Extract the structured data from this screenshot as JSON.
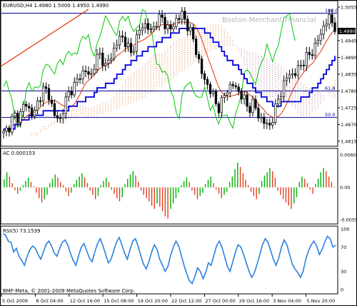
{
  "chart_data": [
    {
      "type": "candlestick",
      "title": "EURUSD,H4 1.4980 1.5000 1.4950 1.4990",
      "watermark": "Boston Merchant Financial",
      "ylim": [
        1.4615,
        1.5055
      ],
      "y_ticks": [
        "1.5055",
        "1.4945",
        "1.4890",
        "1.4835",
        "1.4780",
        "1.4725",
        "1.4670",
        "1.4615"
      ],
      "current_price": "1.4990",
      "fibonacci_levels": [
        {
          "label": "100.0",
          "value": 1.5035
        },
        {
          "label": "61.8",
          "value": 1.478
        },
        {
          "label": "50.0",
          "value": 1.4693
        }
      ],
      "ohlc_close_path": [
        1.464,
        1.466,
        1.47,
        1.469,
        1.474,
        1.472,
        1.47,
        1.476,
        1.479,
        1.476,
        1.47,
        1.468,
        1.474,
        1.478,
        1.48,
        1.483,
        1.485,
        1.482,
        1.488,
        1.49,
        1.486,
        1.489,
        1.493,
        1.496,
        1.494,
        1.49,
        1.495,
        1.499,
        1.5,
        1.497,
        1.501,
        1.502,
        1.499,
        1.498,
        1.502,
        1.503,
        1.5,
        1.496,
        1.49,
        1.483,
        1.48,
        1.477,
        1.472,
        1.475,
        1.479,
        1.48,
        1.478,
        1.476,
        1.472,
        1.474,
        1.47,
        1.468,
        1.466,
        1.47,
        1.476,
        1.48,
        1.484,
        1.483,
        1.486,
        1.488,
        1.49,
        1.492,
        1.496,
        1.5,
        1.502,
        1.499
      ],
      "colors": {
        "bull": "#00c800",
        "bear": "#000000",
        "kijun": "#0000e0",
        "tenkan": "#e03000",
        "chikou": "#00c800",
        "channel": "#e03000",
        "cloud_a": "#e8a070",
        "cloud_b": "#c890b0",
        "fib": "#0000a0"
      }
    },
    {
      "type": "bar",
      "title": "AC 0.000153",
      "y_ticks": [
        "0.006046",
        "0.00",
        "-0.00599"
      ],
      "ylim": [
        -0.006,
        0.006046
      ],
      "values": [
        0.0015,
        0.0028,
        0.002,
        0.0008,
        -0.0005,
        -0.0012,
        -0.0006,
        0.0004,
        0.0012,
        0.0018,
        0.001,
        0.0002,
        -0.001,
        -0.002,
        -0.0028,
        -0.0022,
        -0.0014,
        0.0008,
        0.0016,
        0.0024,
        0.0018,
        0.001,
        0.0004,
        -0.0008,
        -0.0016,
        -0.001,
        0.0006,
        0.0014,
        0.002,
        0.0026,
        0.0018,
        0.0008,
        -0.0006,
        -0.0014,
        -0.0022,
        -0.0016,
        0.0004,
        0.0012,
        0.0018,
        0.001,
        -0.0004,
        -0.0012,
        -0.002,
        -0.0026,
        -0.0018,
        0.0006,
        0.0016,
        0.0024,
        0.003,
        0.0022,
        0.001,
        -0.0006,
        -0.0014,
        -0.002,
        -0.0026,
        -0.0034,
        -0.004,
        -0.003,
        -0.0036,
        -0.0044,
        -0.0054,
        -0.0058,
        -0.004,
        -0.003,
        -0.002,
        -0.001,
        0.0004,
        0.0012,
        0.0018,
        0.001,
        -0.0006,
        -0.0014,
        -0.0022,
        -0.0016,
        -0.001,
        0.0006,
        0.0014,
        0.002,
        0.0008,
        -0.0004,
        -0.0012,
        -0.002,
        -0.0014,
        -0.0008,
        0.001,
        0.002,
        0.0034,
        0.0046,
        0.0038,
        0.0026,
        0.0014,
        0.0004,
        -0.0008,
        -0.0016,
        -0.0022,
        -0.0012,
        0.0012,
        0.0022,
        0.0028,
        0.0036,
        0.003,
        0.0018,
        -0.0006,
        -0.0014,
        -0.0022,
        -0.0028,
        -0.0034,
        -0.004,
        -0.003,
        -0.0018,
        0.001,
        0.002,
        0.0016,
        0.0008,
        -0.0004,
        -0.0012,
        0.0006,
        0.0016,
        0.0028,
        0.0036,
        0.003,
        0.002,
        0.001,
        0.00015
      ],
      "colors": {
        "up": "#00b000",
        "down": "#e04020"
      }
    },
    {
      "type": "line",
      "title": "RSI(5) 73.1539",
      "y_ticks": [
        "100",
        "70",
        "30",
        "0"
      ],
      "ylim": [
        0,
        100
      ],
      "values": [
        92,
        90,
        80,
        78,
        62,
        68,
        55,
        48,
        40,
        55,
        66,
        72,
        68,
        58,
        50,
        62,
        75,
        80,
        72,
        60,
        55,
        68,
        78,
        82,
        74,
        60,
        48,
        40,
        56,
        70,
        76,
        64,
        52,
        46,
        62,
        76,
        84,
        72,
        58,
        44,
        50,
        64,
        78,
        86,
        74,
        60,
        50,
        66,
        80,
        84,
        72,
        56,
        42,
        34,
        46,
        62,
        74,
        66,
        50,
        40,
        30,
        38,
        56,
        70,
        80,
        72,
        56,
        40,
        26,
        14,
        10,
        22,
        36,
        30,
        18,
        28,
        44,
        40,
        56,
        72,
        80,
        70,
        54,
        38,
        30,
        46,
        62,
        74,
        70,
        58,
        44,
        30,
        20,
        28,
        42,
        58,
        74,
        84,
        78,
        64,
        50,
        40,
        52,
        70,
        82,
        74,
        58,
        42,
        34,
        28,
        20,
        30,
        50,
        64,
        74,
        80,
        72,
        58,
        66,
        78,
        88,
        84,
        70,
        73.15
      ],
      "colors": {
        "line": "#2a80e0"
      }
    }
  ],
  "x_axis": {
    "labels": [
      "5 Oct 2009",
      "8 Oct 04:00",
      "12 Oct 16:00",
      "15 Oct 08:00",
      "19 Oct 20:00",
      "22 Oct 12:00",
      "27 Oct 00:00",
      "29 Oct 16:00",
      "3 Nov 04:00",
      "5 Nov 20:00"
    ]
  },
  "footer": "BMF-Meta, © 2001-2009 MetaQuotes Software Corp."
}
